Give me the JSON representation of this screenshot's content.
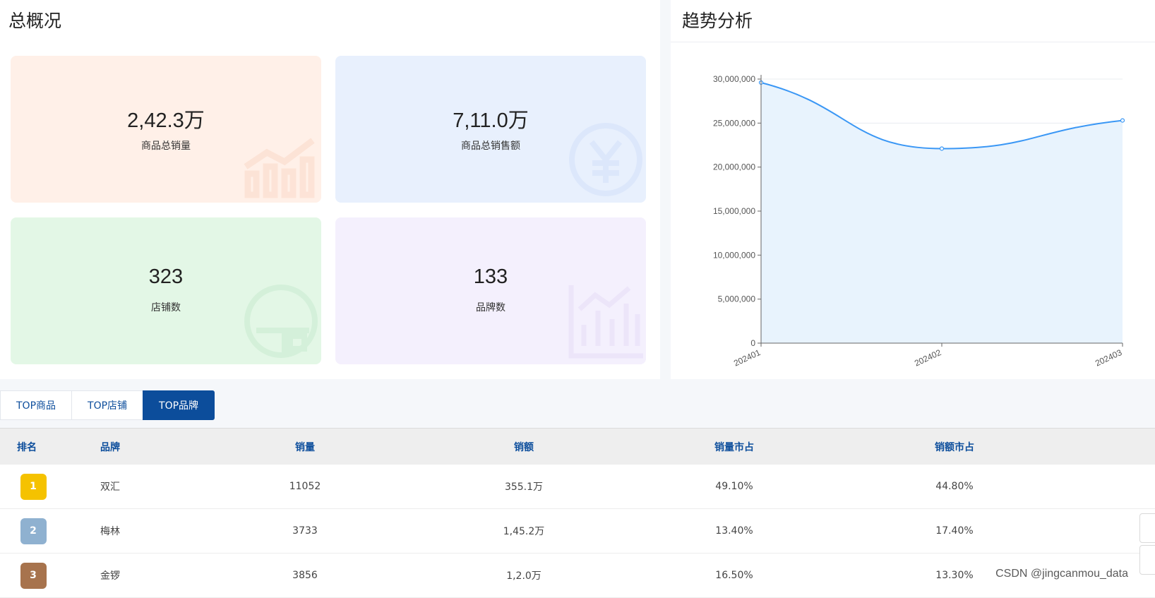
{
  "overview": {
    "title": "总概况",
    "cards": [
      {
        "value": "2,42.3万",
        "label": "商品总销量",
        "icon": "trend-bar-icon"
      },
      {
        "value": "7,11.0万",
        "label": "商品总销售额",
        "icon": "yen-icon"
      },
      {
        "value": "323",
        "label": "店铺数",
        "icon": "store-icon"
      },
      {
        "value": "133",
        "label": "品牌数",
        "icon": "bar-chart-icon"
      }
    ]
  },
  "trend": {
    "title": "趋势分析"
  },
  "chart_data": {
    "type": "area",
    "x": [
      "202401",
      "202402",
      "202403"
    ],
    "series": [
      {
        "values": [
          29600000,
          22100000,
          25300000
        ]
      }
    ],
    "ylim": [
      0,
      30000000
    ],
    "yticks": [
      "0",
      "5,000,000",
      "10,000,000",
      "15,000,000",
      "20,000,000",
      "25,000,000",
      "30,000,000"
    ],
    "grid": true,
    "line_color": "#3a97f5",
    "fill_color": "#e8f3fd"
  },
  "tabs": [
    {
      "label": "TOP商品",
      "active": false
    },
    {
      "label": "TOP店铺",
      "active": false
    },
    {
      "label": "TOP品牌",
      "active": true
    }
  ],
  "table": {
    "headers": [
      "排名",
      "品牌",
      "销量",
      "销额",
      "销量市占",
      "销额市占"
    ],
    "rows": [
      {
        "rank": "1",
        "brand": "双汇",
        "qty": "11052",
        "amt": "355.1万",
        "qshare": "49.10%",
        "ashare": "44.80%",
        "badge": "#f5c200"
      },
      {
        "rank": "2",
        "brand": "梅林",
        "qty": "3733",
        "amt": "1,45.2万",
        "qshare": "13.40%",
        "ashare": "17.40%",
        "badge": "#8fb1d0"
      },
      {
        "rank": "3",
        "brand": "金锣",
        "qty": "3856",
        "amt": "1,2.0万",
        "qshare": "16.50%",
        "ashare": "13.30%",
        "badge": "#a7734d"
      }
    ]
  },
  "watermark": "CSDN @jingcanmou_data"
}
